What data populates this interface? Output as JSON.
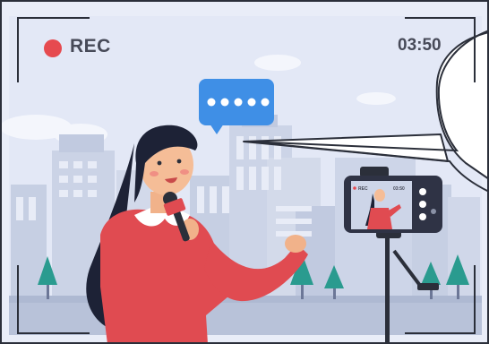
{
  "recording": {
    "label": "REC",
    "timer": "03:50",
    "indicator_color": "#e64a4f"
  },
  "camera_preview": {
    "label": "REC",
    "timer": "03:50"
  },
  "speech_bubble": {
    "dots": 5,
    "color": "#3f8fe6"
  },
  "colors": {
    "sky": "#e6ebf7",
    "buildings": "#c7d0e4",
    "frame": "#2b2f3a",
    "dress": "#e04b51",
    "hair": "#1d2236",
    "trees": "#2a9b8f"
  },
  "icons": [
    "recording-dot-icon",
    "speech-bubble-icon",
    "camera-icon",
    "microphone-icon"
  ]
}
